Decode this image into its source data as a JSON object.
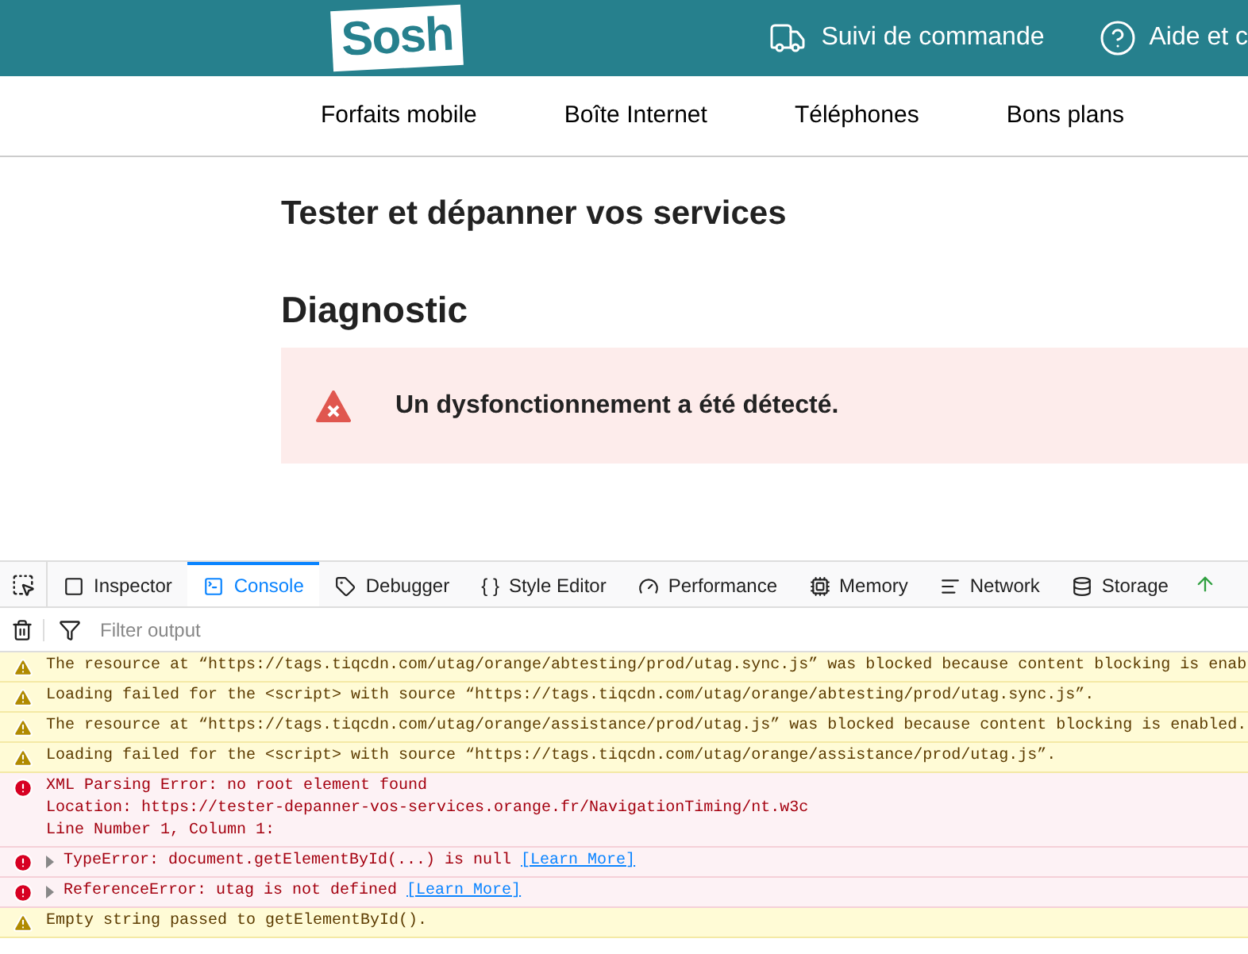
{
  "header": {
    "logo": "Sosh",
    "links": [
      {
        "label": "Suivi de commande",
        "kind": "truck"
      },
      {
        "label": "Aide et c",
        "kind": "help"
      }
    ]
  },
  "nav": [
    "Forfaits mobile",
    "Boîte Internet",
    "Téléphones",
    "Bons plans"
  ],
  "page": {
    "title": "Tester et dépanner vos services",
    "section": "Diagnostic",
    "alert": {
      "kind": "error",
      "text": "Un dysfonctionnement a été détecté."
    }
  },
  "devtools": {
    "tabs": [
      {
        "label": "Inspector",
        "kind": "inspector",
        "selected": false
      },
      {
        "label": "Console",
        "kind": "console",
        "selected": true
      },
      {
        "label": "Debugger",
        "kind": "debugger",
        "selected": false
      },
      {
        "label": "Style Editor",
        "kind": "style",
        "glyph": "{ }",
        "selected": false
      },
      {
        "label": "Performance",
        "kind": "performance",
        "selected": false
      },
      {
        "label": "Memory",
        "kind": "memory",
        "selected": false
      },
      {
        "label": "Network",
        "kind": "network",
        "selected": false
      },
      {
        "label": "Storage",
        "kind": "storage",
        "selected": false
      }
    ],
    "filter": {
      "placeholder": "Filter output"
    },
    "messages": [
      {
        "kind": "warning",
        "lines": [
          "The resource at “https://tags.tiqcdn.com/utag/orange/abtesting/prod/utag.sync.js” was blocked because content blocking is enab"
        ]
      },
      {
        "kind": "warning",
        "lines": [
          "Loading failed for the <script> with source “https://tags.tiqcdn.com/utag/orange/abtesting/prod/utag.sync.js”."
        ]
      },
      {
        "kind": "warning",
        "lines": [
          "The resource at “https://tags.tiqcdn.com/utag/orange/assistance/prod/utag.js” was blocked because content blocking is enabled."
        ]
      },
      {
        "kind": "warning",
        "lines": [
          "Loading failed for the <script> with source “https://tags.tiqcdn.com/utag/orange/assistance/prod/utag.js”."
        ]
      },
      {
        "kind": "error",
        "lines": [
          "XML Parsing Error: no root element found",
          "Location: https://tester-depanner-vos-services.orange.fr/NavigationTiming/nt.w3c",
          "Line Number 1, Column 1:"
        ]
      },
      {
        "kind": "error",
        "expandable": true,
        "lines": [
          "TypeError: document.getElementById(...) is null"
        ],
        "link": "[Learn More]"
      },
      {
        "kind": "error",
        "expandable": true,
        "lines": [
          "ReferenceError: utag is not defined"
        ],
        "link": "[Learn More]"
      },
      {
        "kind": "warning",
        "lines": [
          "Empty string passed to getElementById()."
        ]
      }
    ]
  }
}
